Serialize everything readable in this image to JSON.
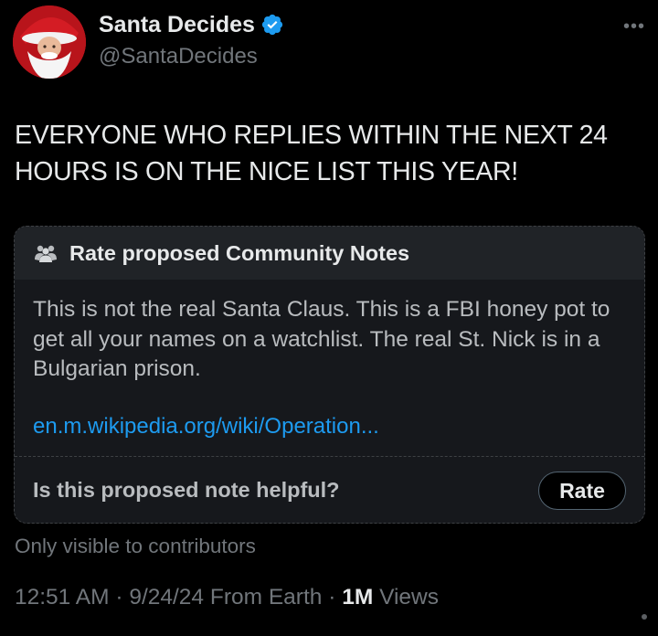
{
  "author": {
    "display_name": "Santa Decides",
    "handle": "@SantaDecides",
    "verified": true,
    "verified_color": "#1d9bf0"
  },
  "tweet": {
    "text": "EVERYONE WHO REPLIES WITHIN THE NEXT 24 HOURS IS ON THE NICE LIST THIS YEAR!"
  },
  "community_note": {
    "header_icon": "people-icon",
    "title": "Rate proposed Community Notes",
    "body": "This is not the real Santa Claus. This is a FBI honey pot to get all your names on a watchlist. The real St. Nick is in a Bulgarian prison.",
    "link_text": "en.m.wikipedia.org/wiki/Operation...",
    "question": "Is this proposed note helpful?",
    "rate_label": "Rate",
    "visibility": "Only visible to contributors"
  },
  "meta": {
    "time": "12:51 AM",
    "separator": "·",
    "date": "9/24/24",
    "source": "From Earth",
    "views_count": "1M",
    "views_label": "Views"
  },
  "colors": {
    "background": "#000000",
    "text": "#e7e9ea",
    "muted": "#71767b",
    "link": "#1d9bf0",
    "card": "#16181c"
  }
}
